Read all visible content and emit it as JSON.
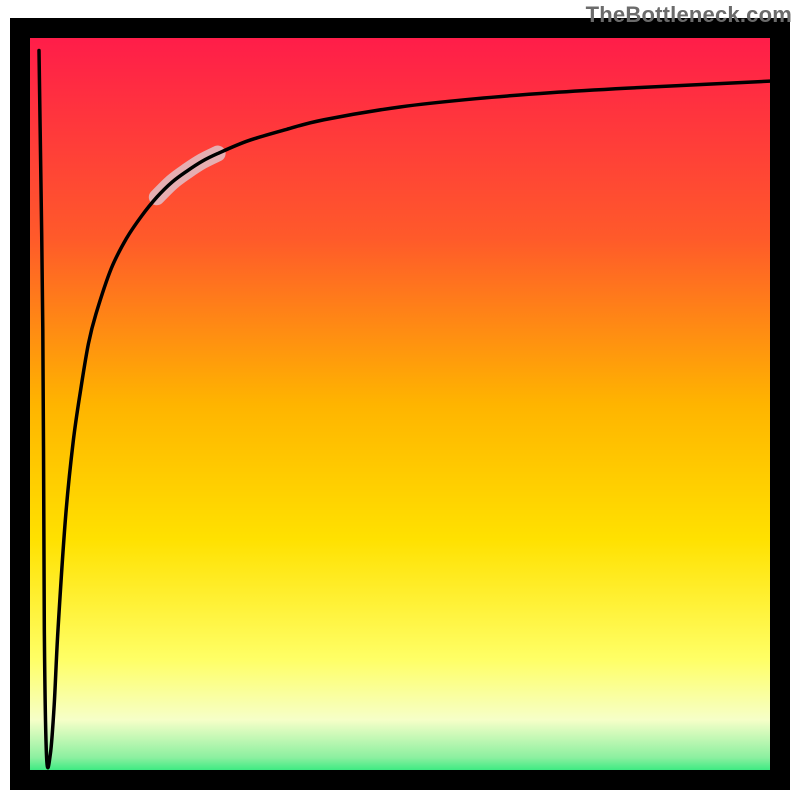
{
  "watermark": "TheBottleneck.com",
  "chart_data": {
    "type": "line",
    "title": "",
    "xlabel": "",
    "ylabel": "",
    "xlim": [
      0,
      100
    ],
    "ylim": [
      0,
      100
    ],
    "grid": false,
    "legend": false,
    "background_gradient": {
      "top": "#ff1a4b",
      "mid_upper": "#ff8a00",
      "mid": "#ffe100",
      "mid_lower": "#ffff66",
      "bottom": "#00e66b"
    },
    "highlight_band_on_curve": {
      "x_start": 18,
      "x_end": 26,
      "color": "#e6aeb2"
    },
    "series": [
      {
        "name": "bottleneck-curve",
        "x": [
          2.5,
          3,
          3.2,
          3.5,
          4,
          4.5,
          5,
          6,
          7,
          8,
          9,
          10,
          12,
          14,
          16,
          18,
          20,
          22,
          24,
          26,
          30,
          35,
          40,
          50,
          60,
          70,
          80,
          90,
          100
        ],
        "y": [
          97,
          60,
          20,
          3,
          3.5,
          10,
          20,
          35,
          45,
          52,
          58,
          62,
          68,
          72,
          75,
          77.5,
          79.5,
          81,
          82.3,
          83.3,
          85,
          86.5,
          87.8,
          89.5,
          90.6,
          91.4,
          92,
          92.5,
          93
        ]
      }
    ]
  }
}
